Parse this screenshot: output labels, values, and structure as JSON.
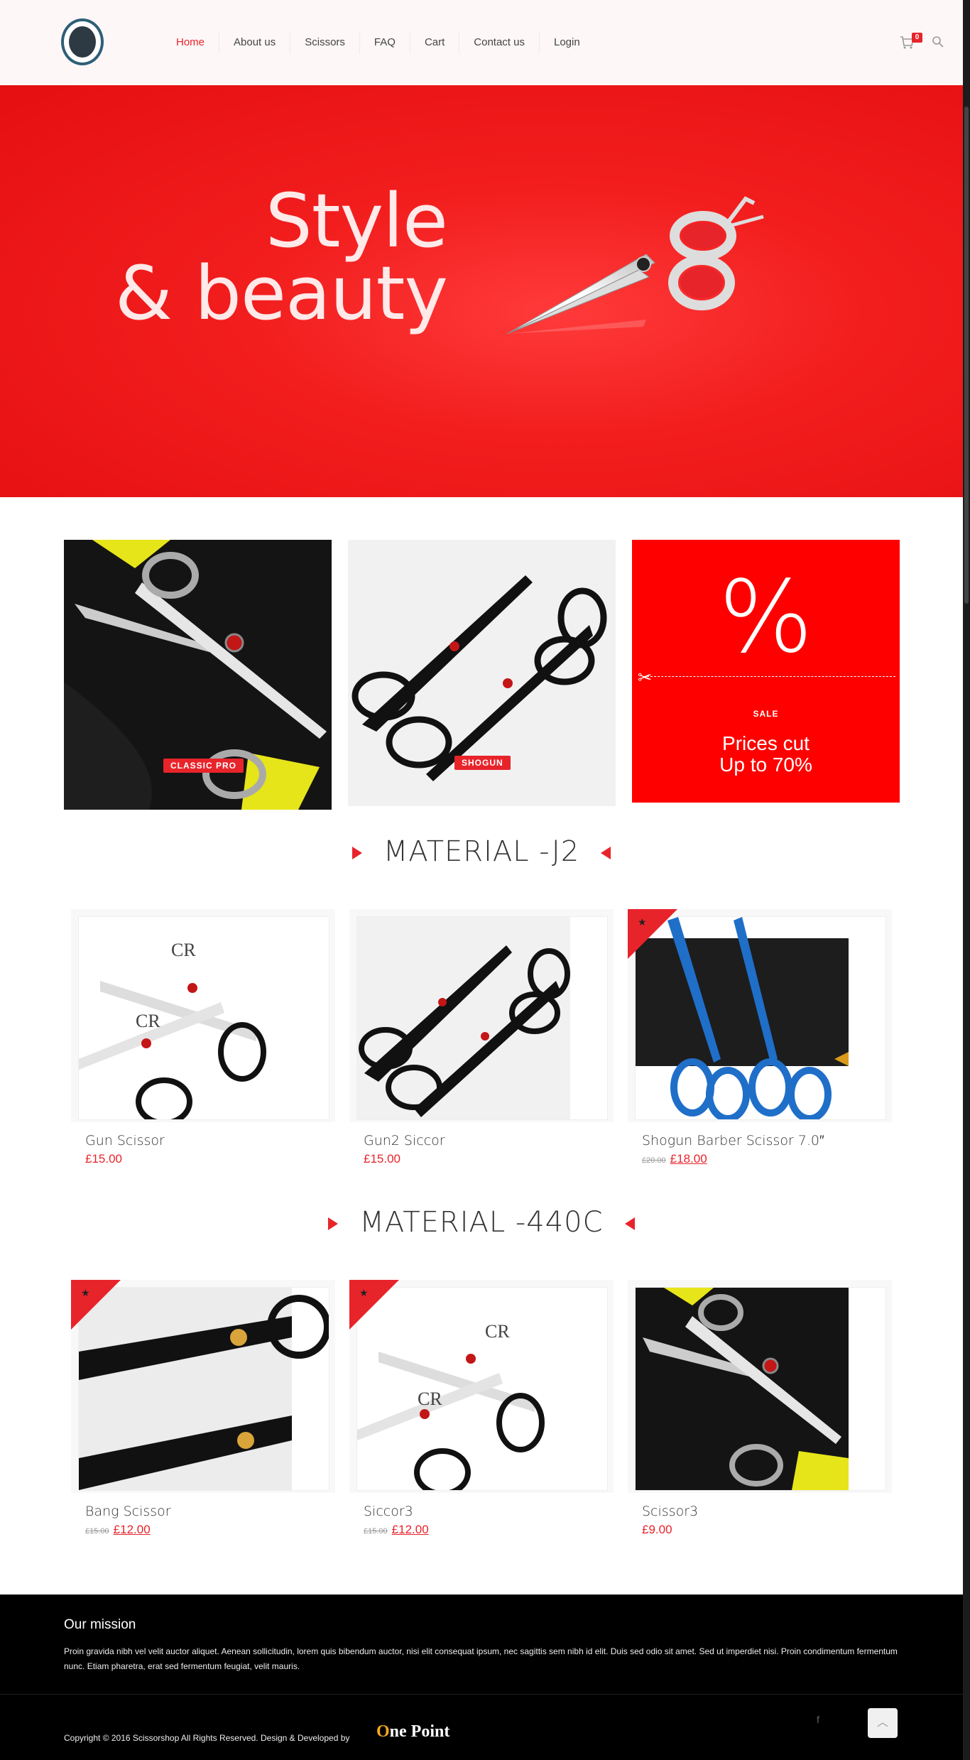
{
  "nav": {
    "items": [
      {
        "label": "Home",
        "active": true
      },
      {
        "label": "About us",
        "active": false
      },
      {
        "label": "Scissors",
        "active": false
      },
      {
        "label": "FAQ",
        "active": false
      },
      {
        "label": "Cart",
        "active": false
      },
      {
        "label": "Contact us",
        "active": false
      },
      {
        "label": "Login",
        "active": false
      }
    ],
    "cart_count": "0"
  },
  "hero": {
    "line1": "Style",
    "line2": "& beauty"
  },
  "promos": {
    "classic_label": "CLASSIC PRO",
    "shogun_label": "SHOGUN",
    "sale_symbol": "%",
    "sale_small": "SALE",
    "sale_line1": "Prices cut",
    "sale_line2": "Up to 70%"
  },
  "sections": {
    "j2_title": "MATERIAL -J2",
    "c440_title": "MATERIAL -440C"
  },
  "products_j2": [
    {
      "name": "Gun Scissor",
      "old_price": "",
      "price": "£15.00"
    },
    {
      "name": "Gun2 Siccor",
      "old_price": "",
      "price": "£15.00"
    },
    {
      "name": "Shogun Barber Scissor 7.0″",
      "old_price": "£20.00",
      "price": "£18.00"
    }
  ],
  "products_440c": [
    {
      "name": "Bang Scissor",
      "old_price": "£15.00",
      "price": "£12.00"
    },
    {
      "name": "Siccor3",
      "old_price": "£15.00",
      "price": "£12.00"
    },
    {
      "name": "Scissor3",
      "old_price": "",
      "price": "£9.00"
    }
  ],
  "footer": {
    "title": "Our mission",
    "text": "Proin gravida nibh vel velit auctor aliquet. Aenean sollicitudin, lorem quis bibendum auctor, nisi elit consequat ipsum, nec sagittis sem nibh id elit. Duis sed odio sit amet. Sed ut imperdiet nisi. Proin condimentum fermentum nunc. Etiam pharetra, erat sed fermentum feugiat, velit mauris.",
    "copyright": "Copyright © 2016 Scissorshop All Rights Reserved. Design & Developed by",
    "brand_o": "O",
    "brand_rest": "ne Point"
  },
  "colors": {
    "accent": "#e8242b",
    "hero": "#f21d1d",
    "sale": "#ff0000"
  }
}
